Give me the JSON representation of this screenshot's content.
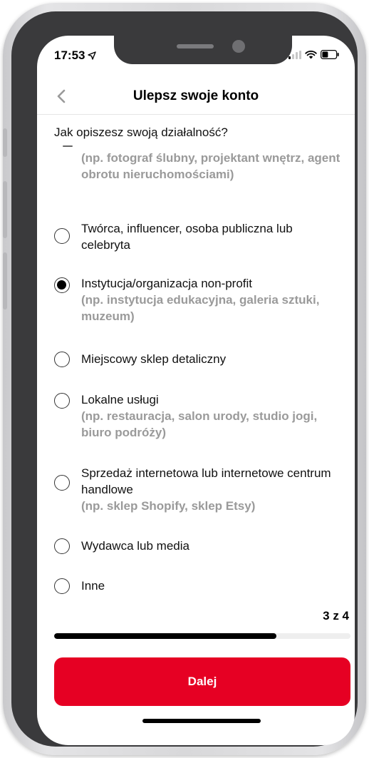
{
  "status_bar": {
    "time": "17:53"
  },
  "header": {
    "title": "Ulepsz swoje konto"
  },
  "question": "Jak opiszesz swoją działalność?",
  "options": [
    {
      "label": "",
      "hint": "(np. fotograf ślubny, projektant wnętrz, agent obrotu nieruchomościami)",
      "selected": false
    },
    {
      "label": "Twórca, influencer, osoba publiczna lub celebryta",
      "hint": "",
      "selected": false
    },
    {
      "label": "Instytucja/organizacja non-profit",
      "hint": "(np. instytucja edukacyjna, galeria sztuki, muzeum)",
      "selected": true
    },
    {
      "label": "Miejscowy sklep detaliczny",
      "hint": "",
      "selected": false
    },
    {
      "label": "Lokalne usługi",
      "hint": "(np. restauracja, salon urody, studio jogi, biuro podróży)",
      "selected": false
    },
    {
      "label": "Sprzedaż internetowa lub internetowe centrum handlowe",
      "hint": "(np. sklep Shopify, sklep Etsy)",
      "selected": false
    },
    {
      "label": "Wydawca lub media",
      "hint": "",
      "selected": false
    },
    {
      "label": "Inne",
      "hint": "",
      "selected": false
    }
  ],
  "progress": {
    "step_label": "3 z 4",
    "fraction": 0.75
  },
  "next_button": {
    "label": "Dalej"
  },
  "colors": {
    "accent": "#e60023",
    "hint_text": "#9a9a9a"
  }
}
